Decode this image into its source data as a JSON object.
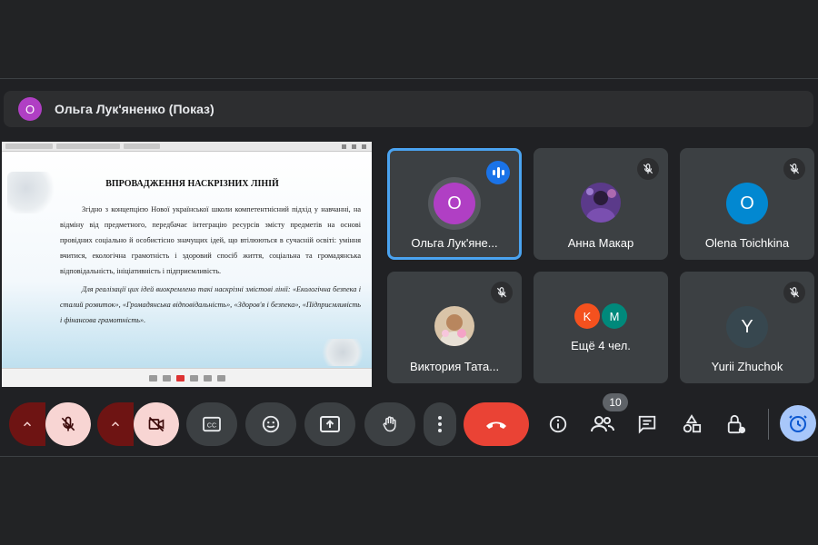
{
  "presenter": {
    "avatar_letter": "О",
    "name": "Ольга Лук'яненко (Показ)"
  },
  "slide": {
    "title": "ВПРОВАДЖЕННЯ НАСКРІЗНИХ ЛІНІЙ",
    "paragraph1": "Згідно з концепцією Нової української школи компетентнісний підхід у навчанні, на відміну від предметного, передбачає інтеграцію ресурсів змісту предметів на основі провідних соціально й особистісно значущих ідей, що втілюються в сучасній освіті: уміння вчитися, екологічна грамотність і здоровий спосіб життя, соціальна та громадянська відповідальність, ініціативність і підприємливість.",
    "paragraph2": "Для реалізації цих ідей виокремлено такі наскрізні змістові лінії: «Екологічна безпека і сталий розвиток», «Громадянська відповідальність», «Здоров'я і безпека», «Підприємливість і фінансова грамотність»."
  },
  "participants": [
    {
      "name": "Ольга Лук'яне...",
      "letter": "О",
      "color": "#b03fc4",
      "state": "speaking"
    },
    {
      "name": "Анна Макар",
      "state": "muted",
      "photo": true
    },
    {
      "name": "Olena Toichkina",
      "letter": "O",
      "color": "#0288d1",
      "state": "muted"
    },
    {
      "name": "Виктория Тата...",
      "state": "muted",
      "photo": true
    },
    {
      "name": "Ещё 4 чел.",
      "letters": [
        "K",
        "M"
      ],
      "colors": [
        "#f4511e",
        "#00897b"
      ]
    },
    {
      "name": "Yurii Zhuchok",
      "letter": "Y",
      "color": "#37474f",
      "state": "muted"
    }
  ],
  "toolbar": {
    "people_count": "10",
    "icons": [
      "chevron-up-icon",
      "mic-off-icon",
      "camera-off-icon",
      "captions-icon",
      "emoji-icon",
      "present-icon",
      "raise-hand-icon",
      "more-icon",
      "hangup-icon",
      "info-icon",
      "people-icon",
      "chat-icon",
      "activities-icon",
      "host-controls-icon",
      "timer-icon"
    ]
  },
  "colors": {
    "background": "#202124",
    "tile": "#3c4043",
    "hangup": "#ea4335",
    "active_border": "#4aa3f0",
    "muted_ctl": "#f8d5d3"
  }
}
